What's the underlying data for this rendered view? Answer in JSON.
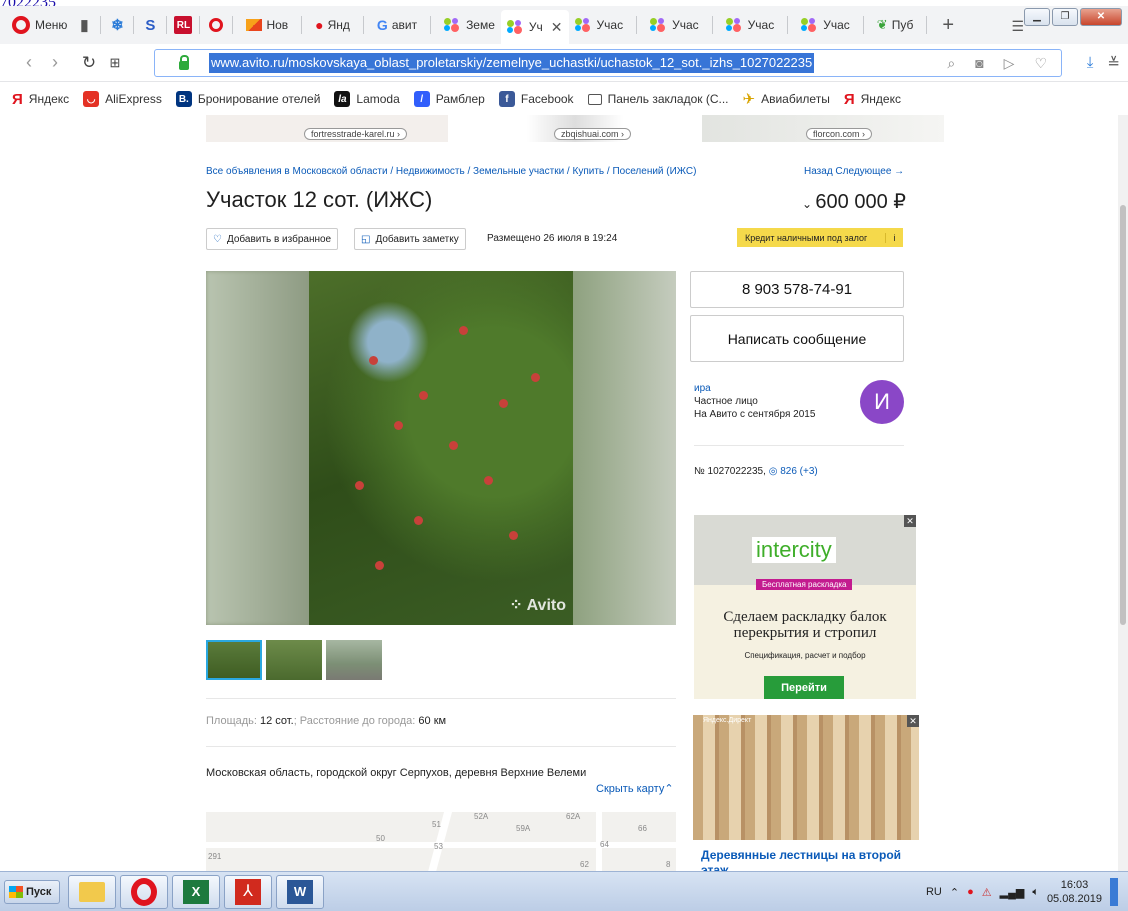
{
  "top_fragment": "7022235",
  "browser": {
    "menu_label": "Меню",
    "tabs": [
      {
        "label": "Нов"
      },
      {
        "label": "Янд"
      },
      {
        "label": "авит"
      },
      {
        "label": "Земе"
      },
      {
        "label": "Уч",
        "active": true
      },
      {
        "label": "Учас"
      },
      {
        "label": "Учас"
      },
      {
        "label": "Учас"
      },
      {
        "label": "Учас"
      },
      {
        "label": "Пуб"
      }
    ],
    "new_tab": "+",
    "url": "www.avito.ru/moskovskaya_oblast_proletarskiy/zemelnye_uchastki/uchastok_12_sot._izhs_1027022235",
    "bookmarks": [
      {
        "label": "Яндекс",
        "icon": "yandex-icon",
        "color": "#e0141e"
      },
      {
        "label": "AliExpress",
        "icon": "aliexpress-icon",
        "color": "#e43225"
      },
      {
        "label": "Бронирование отелей",
        "icon": "booking-icon",
        "color": "#003580"
      },
      {
        "label": "Lamoda",
        "icon": "lamoda-icon",
        "color": "#111111"
      },
      {
        "label": "Рамблер",
        "icon": "rambler-icon",
        "color": "#315efb"
      },
      {
        "label": "Facebook",
        "icon": "facebook-icon",
        "color": "#3b5998"
      },
      {
        "label": "Панель закладок (С...",
        "icon": "folder-icon",
        "color": "#555555"
      },
      {
        "label": "Авиабилеты",
        "icon": "plane-icon",
        "color": "#d8a400"
      },
      {
        "label": "Яндекс",
        "icon": "yandex-icon",
        "color": "#e0141e"
      }
    ]
  },
  "ad_strip": [
    "fortresstrade-karel.ru ›",
    "zbqishuai.com ›",
    "florcon.com ›"
  ],
  "listing": {
    "breadcrumb": "Все объявления в Московской области / Недвижимость / Земельные участки / Купить / Поселений (ИЖС)",
    "back_next": "Назад  Следующее →",
    "title": "Участок 12 сот. (ИЖС)",
    "price": "600 000 ₽",
    "add_favorite": "Добавить в избранное",
    "add_note": "Добавить заметку",
    "placed": "Размещено 26 июля в 19:24",
    "credit": "Кредит наличными под залог",
    "watermark": "Avito",
    "params_area_label": "Площадь:",
    "params_area_value": "12 сот.",
    "params_dist_label": "; Расстояние до города:",
    "params_dist_value": "60 км",
    "address": "Московская область, городской округ Серпухов, деревня Верхние Велеми",
    "hide_map": "Скрыть карту",
    "map_labels": [
      "52А",
      "51",
      "59А",
      "62А",
      "66",
      "50",
      "53",
      "64",
      "291",
      "62",
      "8"
    ]
  },
  "seller": {
    "phone": "8 903 578-74-91",
    "message_button": "Написать сообщение",
    "name": "ира",
    "type": "Частное лицо",
    "since": "На Авито с сентября 2015",
    "avatar_letter": "И",
    "ad_number": "№ 1027022235,",
    "views": "826 (+3)"
  },
  "ads": {
    "ad1_logo": "intercity",
    "ad1_ribbon": "Бесплатная раскладка",
    "ad1_head": "Сделаем раскладку балок перекрытия и стропил",
    "ad1_sub": "Спецификация, расчет и подбор",
    "ad1_button": "Перейти",
    "ad2_tag": "Яндекс.Директ",
    "ad2_title": "Деревянные лестницы на второй этаж"
  },
  "taskbar": {
    "start_label": "Пуск",
    "lang": "RU",
    "time": "16:03",
    "date": "05.08.2019"
  }
}
